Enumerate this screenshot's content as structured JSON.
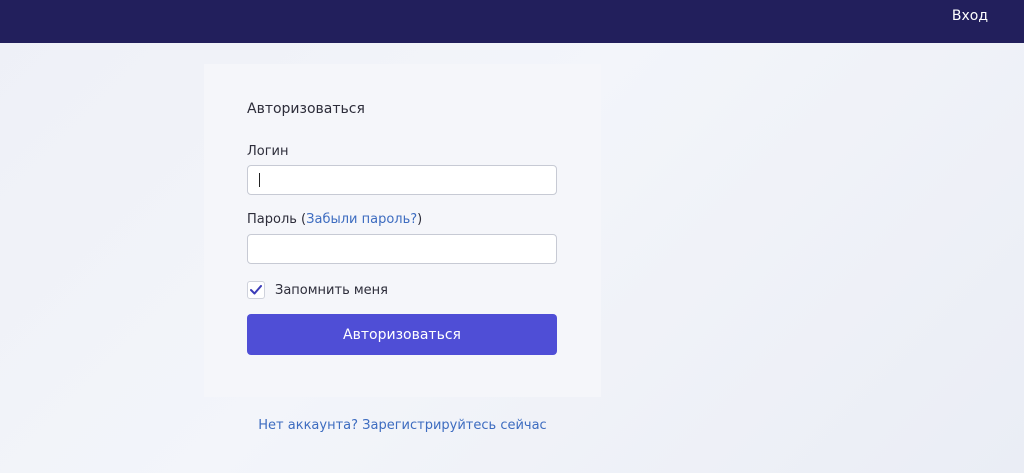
{
  "header": {
    "login_link": "Вход",
    "background": "#221f5c"
  },
  "form": {
    "title": "Авторизоваться",
    "login_label": "Логин",
    "login_value": "",
    "password_label": "Пароль",
    "password_paren_open": " (",
    "forgot_link": "Забыли пароль?",
    "password_paren_close": ")",
    "password_value": "",
    "remember_label": "Запомнить меня",
    "remember_checked": true,
    "submit_label": "Авторизоваться",
    "accent": "#4f4ed6"
  },
  "footer": {
    "register_link": "Нет аккаунта? Зарегистрируйтесь сейчас"
  }
}
